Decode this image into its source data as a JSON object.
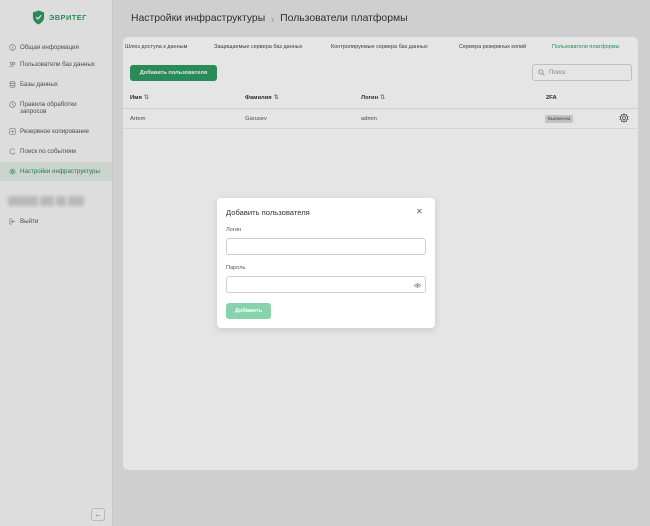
{
  "brand": {
    "name": "ЭВРИТЕГ"
  },
  "sidebar": {
    "items": [
      {
        "label": "Общая информация",
        "icon": "info-icon",
        "active": false
      },
      {
        "label": "Пользователи баз данных",
        "icon": "users-icon",
        "active": false
      },
      {
        "label": "Базы данных",
        "icon": "database-icon",
        "active": false
      },
      {
        "label": "Правила обработки запросов",
        "icon": "rules-icon",
        "active": false
      },
      {
        "label": "Резервное копирование",
        "icon": "backup-icon",
        "active": false
      },
      {
        "label": "Поиск по событиям",
        "icon": "search-events-icon",
        "active": false
      },
      {
        "label": "Настройки инфраструктуры",
        "icon": "gear-icon",
        "active": true
      }
    ],
    "logout_label": "Выйти",
    "collapse_icon": "arrow-left-icon"
  },
  "header": {
    "breadcrumb_root": "Настройки инфраструктуры",
    "breadcrumb_current": "Пользователи платформы"
  },
  "tabs": [
    {
      "label": "Шлюз доступа к данным",
      "active": false
    },
    {
      "label": "Защищаемые сервера баз данных",
      "active": false
    },
    {
      "label": "Контролируемые сервера баз данных",
      "active": false
    },
    {
      "label": "Сервера резервных копий",
      "active": false
    },
    {
      "label": "Пользователи платформы",
      "active": true
    }
  ],
  "toolbar": {
    "add_user_label": "Добавить пользователя",
    "search_placeholder": "Поиск"
  },
  "table": {
    "columns": [
      "Имя",
      "Фамилия",
      "Логин",
      "2FA"
    ],
    "rows": [
      {
        "first_name": "Artem",
        "last_name": "Garusev",
        "login": "admin",
        "twofa": "Выключена"
      }
    ]
  },
  "modal": {
    "title": "Добавить пользователя",
    "login_label": "Логин",
    "login_value": "",
    "password_label": "Пароль",
    "password_value": "",
    "submit_label": "Добавить"
  },
  "colors": {
    "accent": "#2e9b63",
    "accent_disabled": "#87d3ae"
  }
}
